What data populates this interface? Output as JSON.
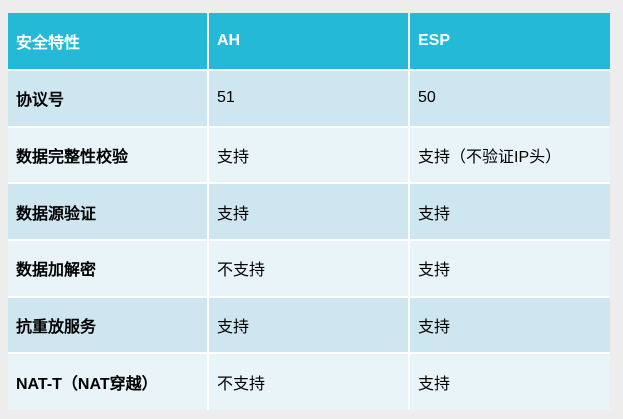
{
  "table": {
    "headers": [
      "安全特性",
      "AH",
      "ESP"
    ],
    "rows": [
      [
        "协议号",
        "51",
        "50"
      ],
      [
        "数据完整性校验",
        "支持",
        "支持（不验证IP头）"
      ],
      [
        "数据源验证",
        "支持",
        "支持"
      ],
      [
        "数据加解密",
        "不支持",
        "支持"
      ],
      [
        "抗重放服务",
        "支持",
        "支持"
      ],
      [
        "NAT-T（NAT穿越）",
        "不支持",
        "支持"
      ]
    ]
  },
  "colors": {
    "header_bg": "#23b9d7",
    "row_odd_bg": "#cde6ef",
    "row_even_bg": "#e8f4f8",
    "page_bg": "#ededed"
  }
}
